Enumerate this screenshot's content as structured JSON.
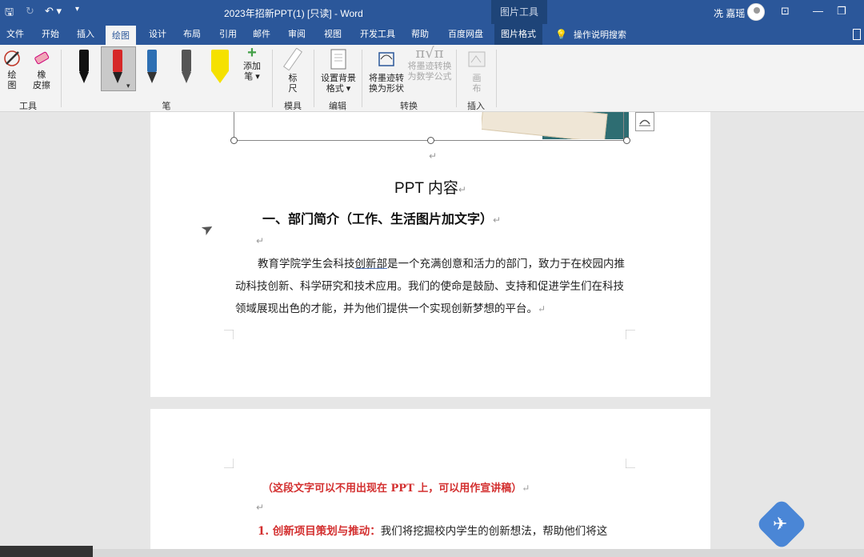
{
  "titlebar": {
    "doc_title": "2023年招新PPT(1) [只读]  -  Word",
    "context_tool": "图片工具",
    "user": "冼 嘉瑶"
  },
  "tabs": [
    "文件",
    "开始",
    "插入",
    "绘图",
    "设计",
    "布局",
    "引用",
    "邮件",
    "审阅",
    "视图",
    "开发工具",
    "帮助",
    "百度网盘",
    "图片格式"
  ],
  "active_tab": "绘图",
  "search": {
    "label": "操作说明搜索"
  },
  "ribbon": {
    "tools": {
      "draw": "绘\n图",
      "eraser": "橡\n皮擦",
      "group": "工具"
    },
    "pens": {
      "add": "添加\n笔 ▾",
      "group": "笔"
    },
    "stencil": {
      "ruler": "标\n尺",
      "group": "模具"
    },
    "edit": {
      "bg": "设置背景\n格式 ▾",
      "group": "编辑"
    },
    "convert": {
      "to_shape": "将墨迹转\n换为形状",
      "to_math": "将墨迹转换\n为数学公式",
      "group": "转换"
    },
    "insert": {
      "canvas": "画\n布",
      "group": "插入"
    },
    "pen_colors": [
      "#111111",
      "#d62828",
      "#2d6fb3",
      "#444444",
      "#f5e100"
    ]
  },
  "document": {
    "page1": {
      "title": "PPT 内容",
      "heading": "一、部门简介（工作、生活图片加文字）",
      "body_before": "教育学院学生会科技",
      "body_underlined": "创新部",
      "body_after": "是一个充满创意和活力的部门，致力于在校园内推动科技创新、科学研究和技术应用。我们的使命是鼓励、支持和促进学生们在科技领域展现出色的才能，并为他们提供一个实现创新梦想的平台。"
    },
    "page2": {
      "note": "（这段文字可以不用出现在 PPT 上，可以用作宣讲稿）",
      "item1_label": "1.  创新项目策划与推动：",
      "item1_text": "我们将挖掘校内学生的创新想法，帮助他们将这"
    }
  },
  "para_mark": "↵"
}
